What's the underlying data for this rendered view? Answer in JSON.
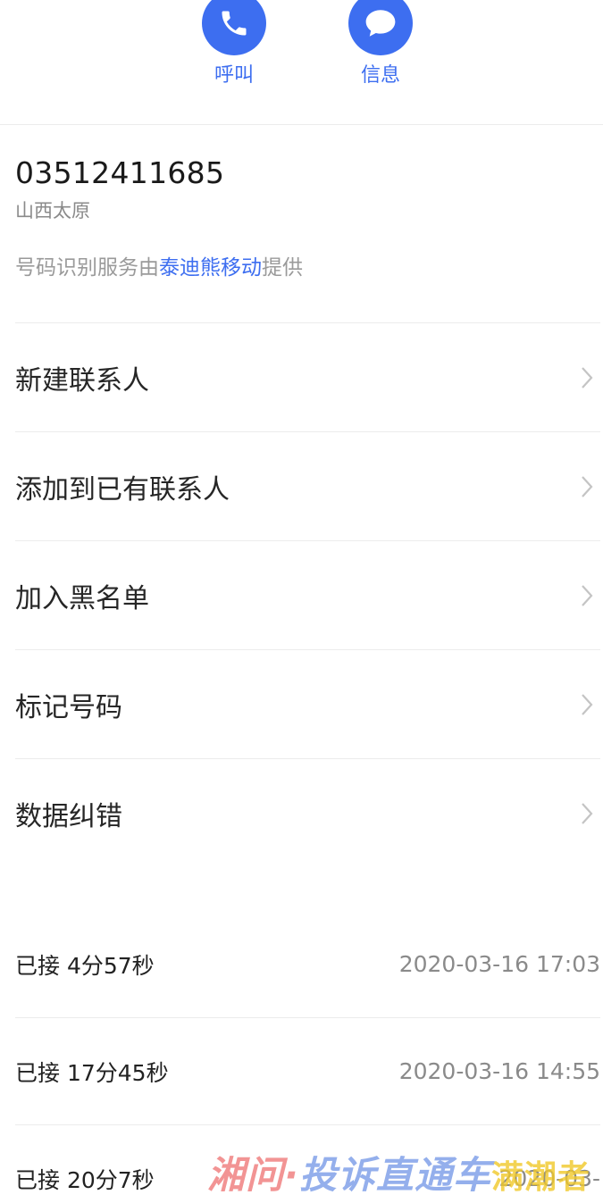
{
  "actions": {
    "call_label": "呼叫",
    "message_label": "信息",
    "icons": [
      "phone-icon",
      "chat-bubble-icon"
    ],
    "accent_color": "#3d6ef0"
  },
  "contact": {
    "number": "03512411685",
    "location": "山西太原",
    "provider_prefix": "号码识别服务由",
    "provider_name": "泰迪熊移动",
    "provider_suffix": "提供"
  },
  "menu": {
    "items": [
      {
        "label": "新建联系人"
      },
      {
        "label": "添加到已有联系人"
      },
      {
        "label": "加入黑名单"
      },
      {
        "label": "标记号码"
      },
      {
        "label": "数据纠错"
      }
    ]
  },
  "calls": [
    {
      "status": "已接 4分57秒",
      "time": "2020-03-16 17:03"
    },
    {
      "status": "已接 17分45秒",
      "time": "2020-03-16 14:55"
    },
    {
      "status": "已接 20分7秒",
      "time": "2020-03-"
    }
  ],
  "watermark": {
    "part1": "湘问·",
    "part2": "投诉直通车",
    "part3": "满潮者"
  }
}
